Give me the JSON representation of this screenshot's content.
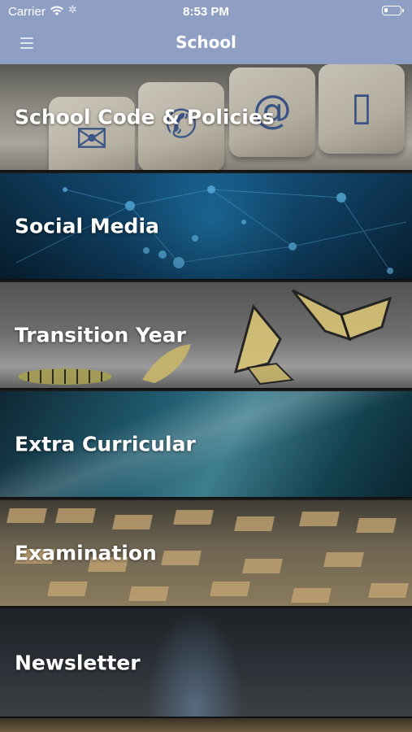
{
  "status_bar": {
    "carrier": "Carrier",
    "time": "8:53 PM",
    "battery_level_fraction": 0.2
  },
  "nav_bar": {
    "title": "School"
  },
  "menu": {
    "items": [
      {
        "label": "School Code & Policies"
      },
      {
        "label": "Social Media"
      },
      {
        "label": "Transition Year"
      },
      {
        "label": "Extra Curricular"
      },
      {
        "label": "Examination"
      },
      {
        "label": "Newsletter"
      }
    ]
  },
  "colors": {
    "nav_bar_background": "#8f9fc4",
    "text": "#ffffff"
  }
}
